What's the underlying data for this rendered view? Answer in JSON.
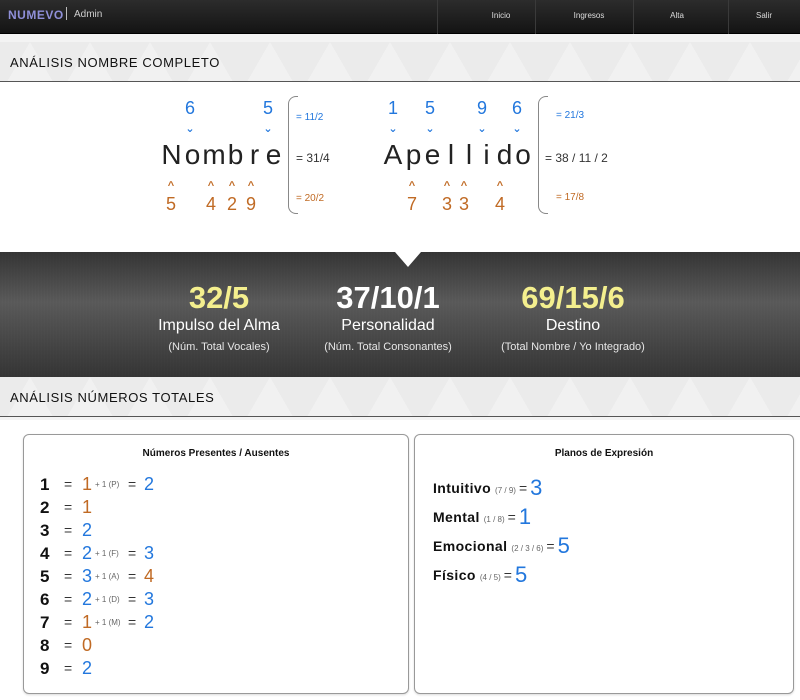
{
  "navbar": {
    "brand": "NUMEVO",
    "subtitle": "Admin",
    "items": [
      "Inicio",
      "Ingresos",
      "Alta",
      "Salir"
    ]
  },
  "colors": {
    "accent_blue": "#2277dd",
    "accent_orange": "#c06a24",
    "highlight_yellow": "#f4ef8e",
    "brand": "#8f8fd8"
  },
  "name_analysis": {
    "title": "ANÁLISIS NOMBRE COMPLETO",
    "first": {
      "letters": [
        "N",
        "o",
        "m",
        "b",
        "r",
        "e"
      ],
      "vowel_digits": [
        "6",
        "5"
      ],
      "consonant_digits": [
        "5",
        "4",
        "2",
        "9"
      ],
      "vowel_sum": "= 11/2",
      "total_sum": "= 31/4",
      "consonant_sum": "= 20/2"
    },
    "last": {
      "letters": [
        "A",
        "p",
        "e",
        "l",
        "l",
        "i",
        "d",
        "o"
      ],
      "vowel_digits": [
        "1",
        "5",
        "9",
        "6"
      ],
      "consonant_digits": [
        "7",
        "3",
        "3",
        "4"
      ],
      "vowel_sum": "= 21/3",
      "total_sum": "= 38 / 11 / 2",
      "consonant_sum": "= 17/8"
    },
    "chevron_down": "⌄",
    "chevron_up": "^"
  },
  "summary": [
    {
      "value": "32/5",
      "label": "Impulso del Alma",
      "sub": "(Núm. Total Vocales)"
    },
    {
      "value": "37/10/1",
      "label": "Personalidad",
      "sub": "(Núm. Total Consonantes)"
    },
    {
      "value": "69/15/6",
      "label": "Destino",
      "sub": "(Total Nombre / Yo Integrado)"
    }
  ],
  "totals": {
    "title": "ANÁLISIS NÚMEROS TOTALES",
    "present_panel": {
      "title": "Números Presentes / Ausentes",
      "rows": [
        {
          "n": "1",
          "eq": "=",
          "a": "1",
          "plus": "+ 1 (P)",
          "eq2": "=",
          "b": "2"
        },
        {
          "n": "2",
          "eq": "=",
          "a": "1"
        },
        {
          "n": "3",
          "eq": "=",
          "a": "2"
        },
        {
          "n": "4",
          "eq": "=",
          "a": "2",
          "plus": "+ 1 (F)",
          "eq2": "=",
          "b": "3"
        },
        {
          "n": "5",
          "eq": "=",
          "a": "3",
          "plus": "+ 1 (A)",
          "eq2": "=",
          "b": "4"
        },
        {
          "n": "6",
          "eq": "=",
          "a": "2",
          "plus": "+ 1 (D)",
          "eq2": "=",
          "b": "3"
        },
        {
          "n": "7",
          "eq": "=",
          "a": "1",
          "plus": "+ 1 (M)",
          "eq2": "=",
          "b": "2"
        },
        {
          "n": "8",
          "eq": "=",
          "a": "0"
        },
        {
          "n": "9",
          "eq": "=",
          "a": "2"
        }
      ]
    },
    "planes_panel": {
      "title": "Planos de Expresión",
      "rows": [
        {
          "name": "Intuitivo",
          "ref": "(7 / 9)",
          "eq": "=",
          "value": "3"
        },
        {
          "name": "Mental",
          "ref": "(1 / 8)",
          "eq": "=",
          "value": "1"
        },
        {
          "name": "Emocional",
          "ref": "(2 / 3 / 6)",
          "eq": "=",
          "value": "5"
        },
        {
          "name": "Físico",
          "ref": "(4 / 5)",
          "eq": "=",
          "value": "5"
        }
      ]
    }
  }
}
